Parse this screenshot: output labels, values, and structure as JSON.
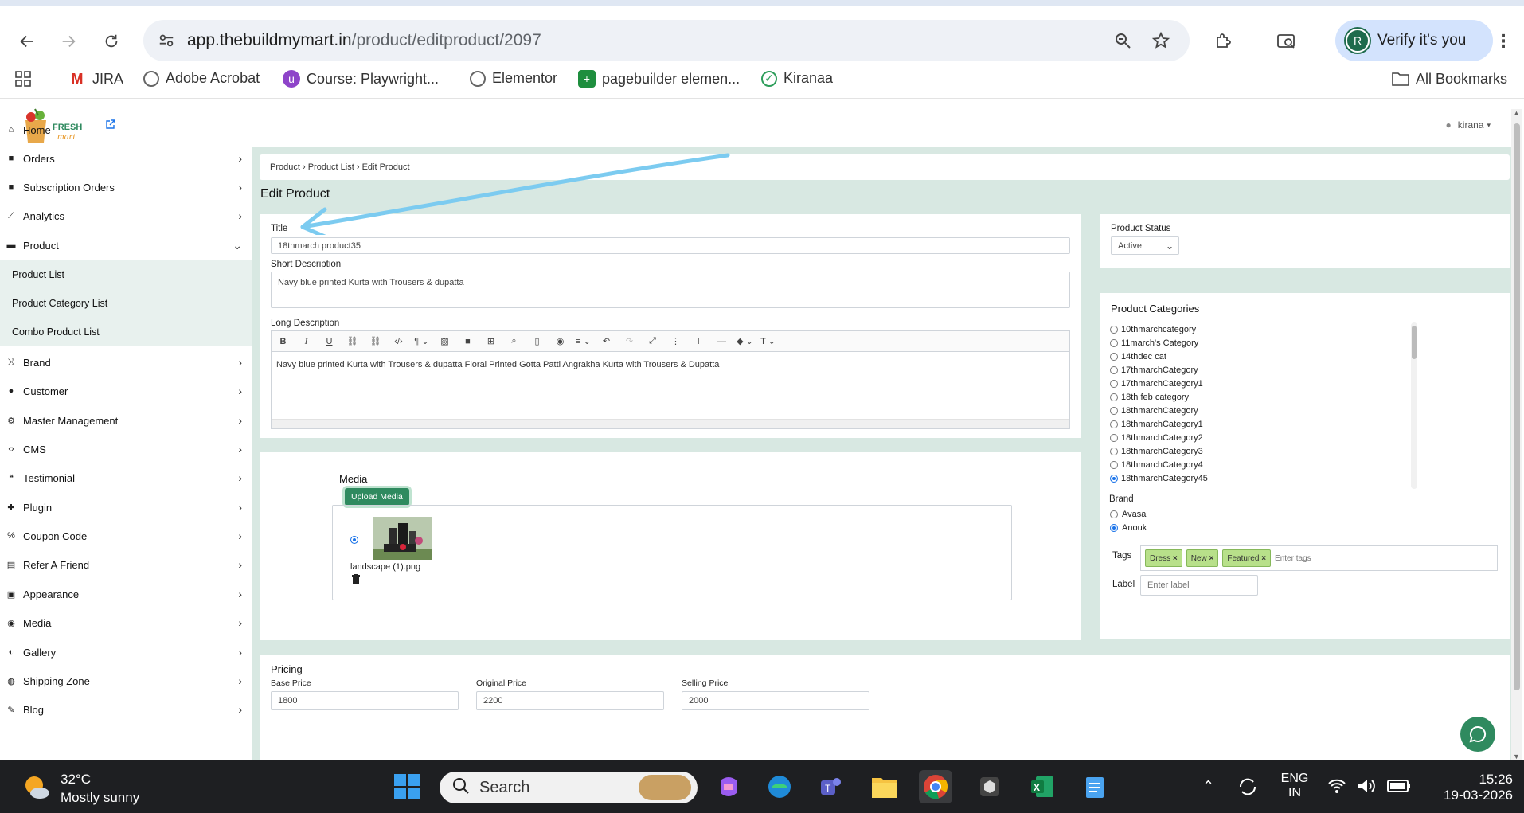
{
  "browser": {
    "url_host": "app.thebuildmymart.in",
    "url_path": "/product/editproduct/2097",
    "profile_initial": "R",
    "verify_label": "Verify it's you"
  },
  "bookmarks": {
    "items": [
      "JIRA",
      "Adobe Acrobat",
      "Course: Playwright...",
      "Elementor",
      "pagebuilder elemen...",
      "Kiranaa"
    ],
    "all_bookmarks": "All Bookmarks"
  },
  "app": {
    "logo_text_1": "FRESH",
    "logo_text_2": "mart",
    "user_name": "kirana",
    "sidebar": {
      "home": "Home",
      "orders": "Orders",
      "subscription_orders": "Subscription Orders",
      "analytics": "Analytics",
      "product": "Product",
      "product_list": "Product List",
      "product_category_list": "Product Category List",
      "combo_product_list": "Combo Product List",
      "brand": "Brand",
      "customer": "Customer",
      "master_management": "Master Management",
      "cms": "CMS",
      "testimonial": "Testimonial",
      "plugin": "Plugin",
      "coupon_code": "Coupon Code",
      "refer_a_friend": "Refer A Friend",
      "appearance": "Appearance",
      "media": "Media",
      "gallery": "Gallery",
      "shipping_zone": "Shipping Zone",
      "blog": "Blog"
    },
    "breadcrumb": {
      "part1": "Product",
      "part2": "Product List",
      "part3": "Edit Product"
    },
    "page_title": "Edit Product",
    "form": {
      "title_label": "Title",
      "title_value": "18thmarch product35",
      "short_desc_label": "Short Description",
      "short_desc_value": "Navy blue printed Kurta with Trousers & dupatta",
      "long_desc_label": "Long Description",
      "long_desc_value": "Navy blue printed Kurta with Trousers & dupatta Floral Printed Gotta Patti Angrakha Kurta with Trousers & Dupatta"
    },
    "media": {
      "heading": "Media",
      "upload_button": "Upload Media",
      "file_name": "landscape (1).png"
    },
    "status": {
      "label": "Product Status",
      "value": "Active"
    },
    "categories": {
      "heading": "Product Categories",
      "items": [
        "10thmarchcategory",
        "11march's Category",
        "14thdec cat",
        "17thmarchCategory",
        "17thmarchCategory1",
        "18th feb category",
        "18thmarchCategory",
        "18thmarchCategory1",
        "18thmarchCategory2",
        "18thmarchCategory3",
        "18thmarchCategory4",
        "18thmarchCategory45"
      ],
      "selected": "18thmarchCategory45"
    },
    "brand": {
      "label": "Brand",
      "items": [
        "Avasa",
        "Anouk"
      ],
      "selected": "Anouk"
    },
    "tags": {
      "label": "Tags",
      "items": [
        "Dress",
        "New",
        "Featured"
      ],
      "placeholder": "Enter tags"
    },
    "label_field": {
      "label": "Label",
      "placeholder": "Enter label"
    },
    "pricing": {
      "heading": "Pricing",
      "base_label": "Base Price",
      "base_value": "1800",
      "original_label": "Original Price",
      "original_value": "2200",
      "selling_label": "Selling Price",
      "selling_value": "2000"
    }
  },
  "taskbar": {
    "weather_temp": "32°C",
    "weather_desc": "Mostly sunny",
    "search_label": "Search",
    "lang_1": "ENG",
    "lang_2": "IN",
    "time": "15:26",
    "date": "19-03-2026"
  },
  "colors": {
    "accent_green": "#2f8a5f",
    "main_bg": "#d8e8e2",
    "tag_green": "#b8e08a",
    "annotation_arrow": "#7ccbf0"
  }
}
